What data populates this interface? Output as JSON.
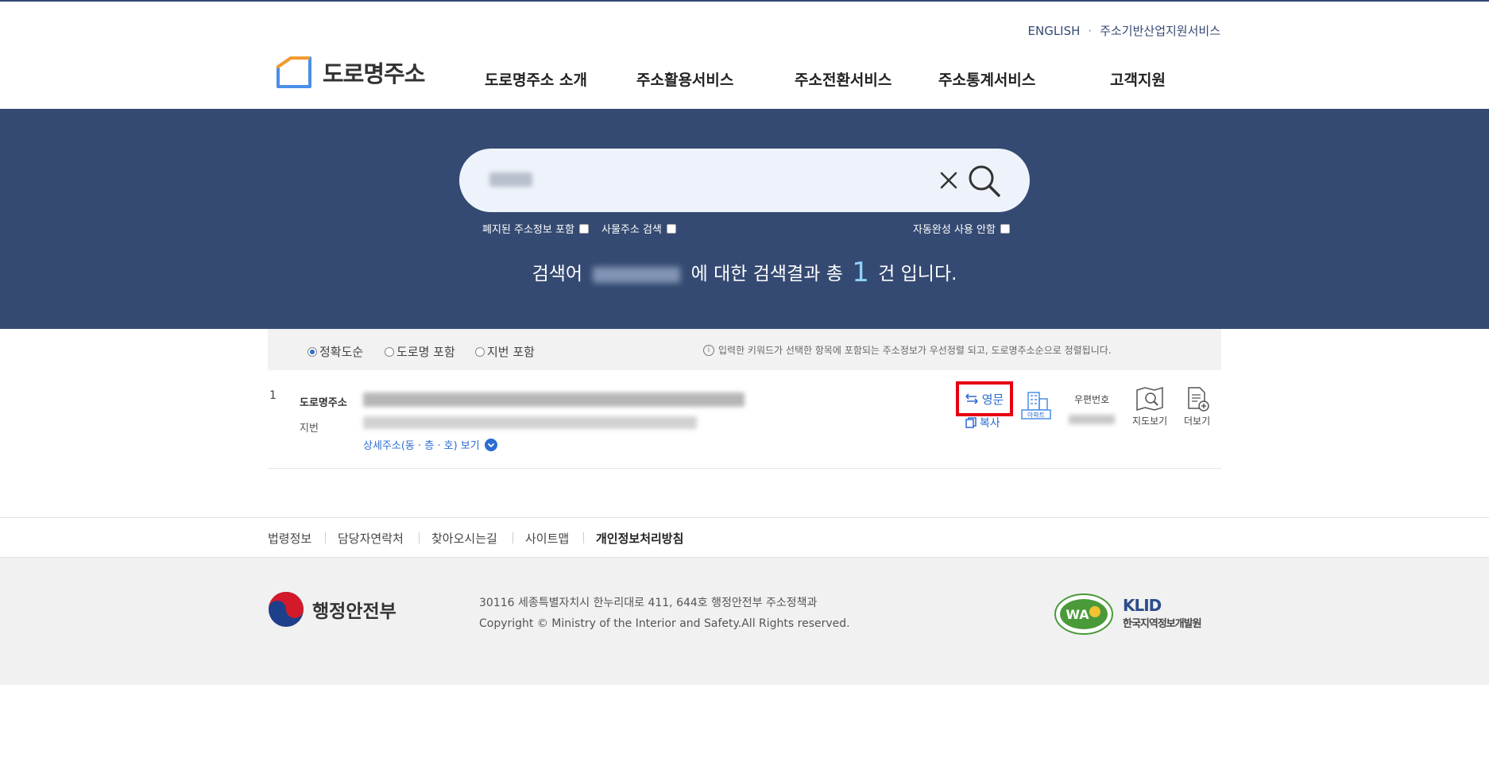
{
  "util_links": {
    "english": "ENGLISH",
    "separator": "·",
    "industry": "주소기반산업지원서비스"
  },
  "logo": {
    "text": "도로명주소"
  },
  "gnb": [
    "도로명주소 소개",
    "주소활용서비스",
    "주소전환서비스",
    "주소통계서비스",
    "고객지원"
  ],
  "search": {
    "options": [
      {
        "label": "폐지된 주소정보 포함",
        "checked": false
      },
      {
        "label": "사물주소 검색",
        "checked": false
      },
      {
        "label": "자동완성 사용 안함",
        "checked": false
      }
    ],
    "summary_prefix": "검색어",
    "summary_mid": "에 대한 검색결과 총",
    "count": "1",
    "summary_suffix": "건 입니다."
  },
  "sort": {
    "options": [
      {
        "label": "정확도순",
        "selected": true
      },
      {
        "label": "도로명 포함",
        "selected": false
      },
      {
        "label": "지번 포함",
        "selected": false
      }
    ],
    "hint": "입력한 키워드가 선택한 항목에 포함되는 주소정보가 우선정렬 되고, 도로명주소순으로 정렬됩니다."
  },
  "result": {
    "num": "1",
    "road_label": "도로명주소",
    "jibun_label": "지번",
    "detail_link": "상세주소(동 · 층 · 호) 보기",
    "english_btn": "영문",
    "copy_btn": "복사",
    "apt_label": "아파트",
    "zip_label": "우편번호",
    "map_btn": "지도보기",
    "more_btn": "더보기"
  },
  "footer_links": [
    "법령정보",
    "담당자연락처",
    "찾아오시는길",
    "사이트맵",
    "개인정보처리방침"
  ],
  "footer": {
    "org": "행정안전부",
    "address": "30116 세종특별자치시 한누리대로 411, 644호 행정안전부 주소정책과",
    "copyright": "Copyright © Ministry of the Interior and Safety.All Rights reserved.",
    "klid_en": "KLID",
    "klid_ko": "한국지역정보개발원"
  },
  "colors": {
    "banner": "#354a72",
    "accent": "#2b6cd4",
    "highlight": "#e60012"
  }
}
